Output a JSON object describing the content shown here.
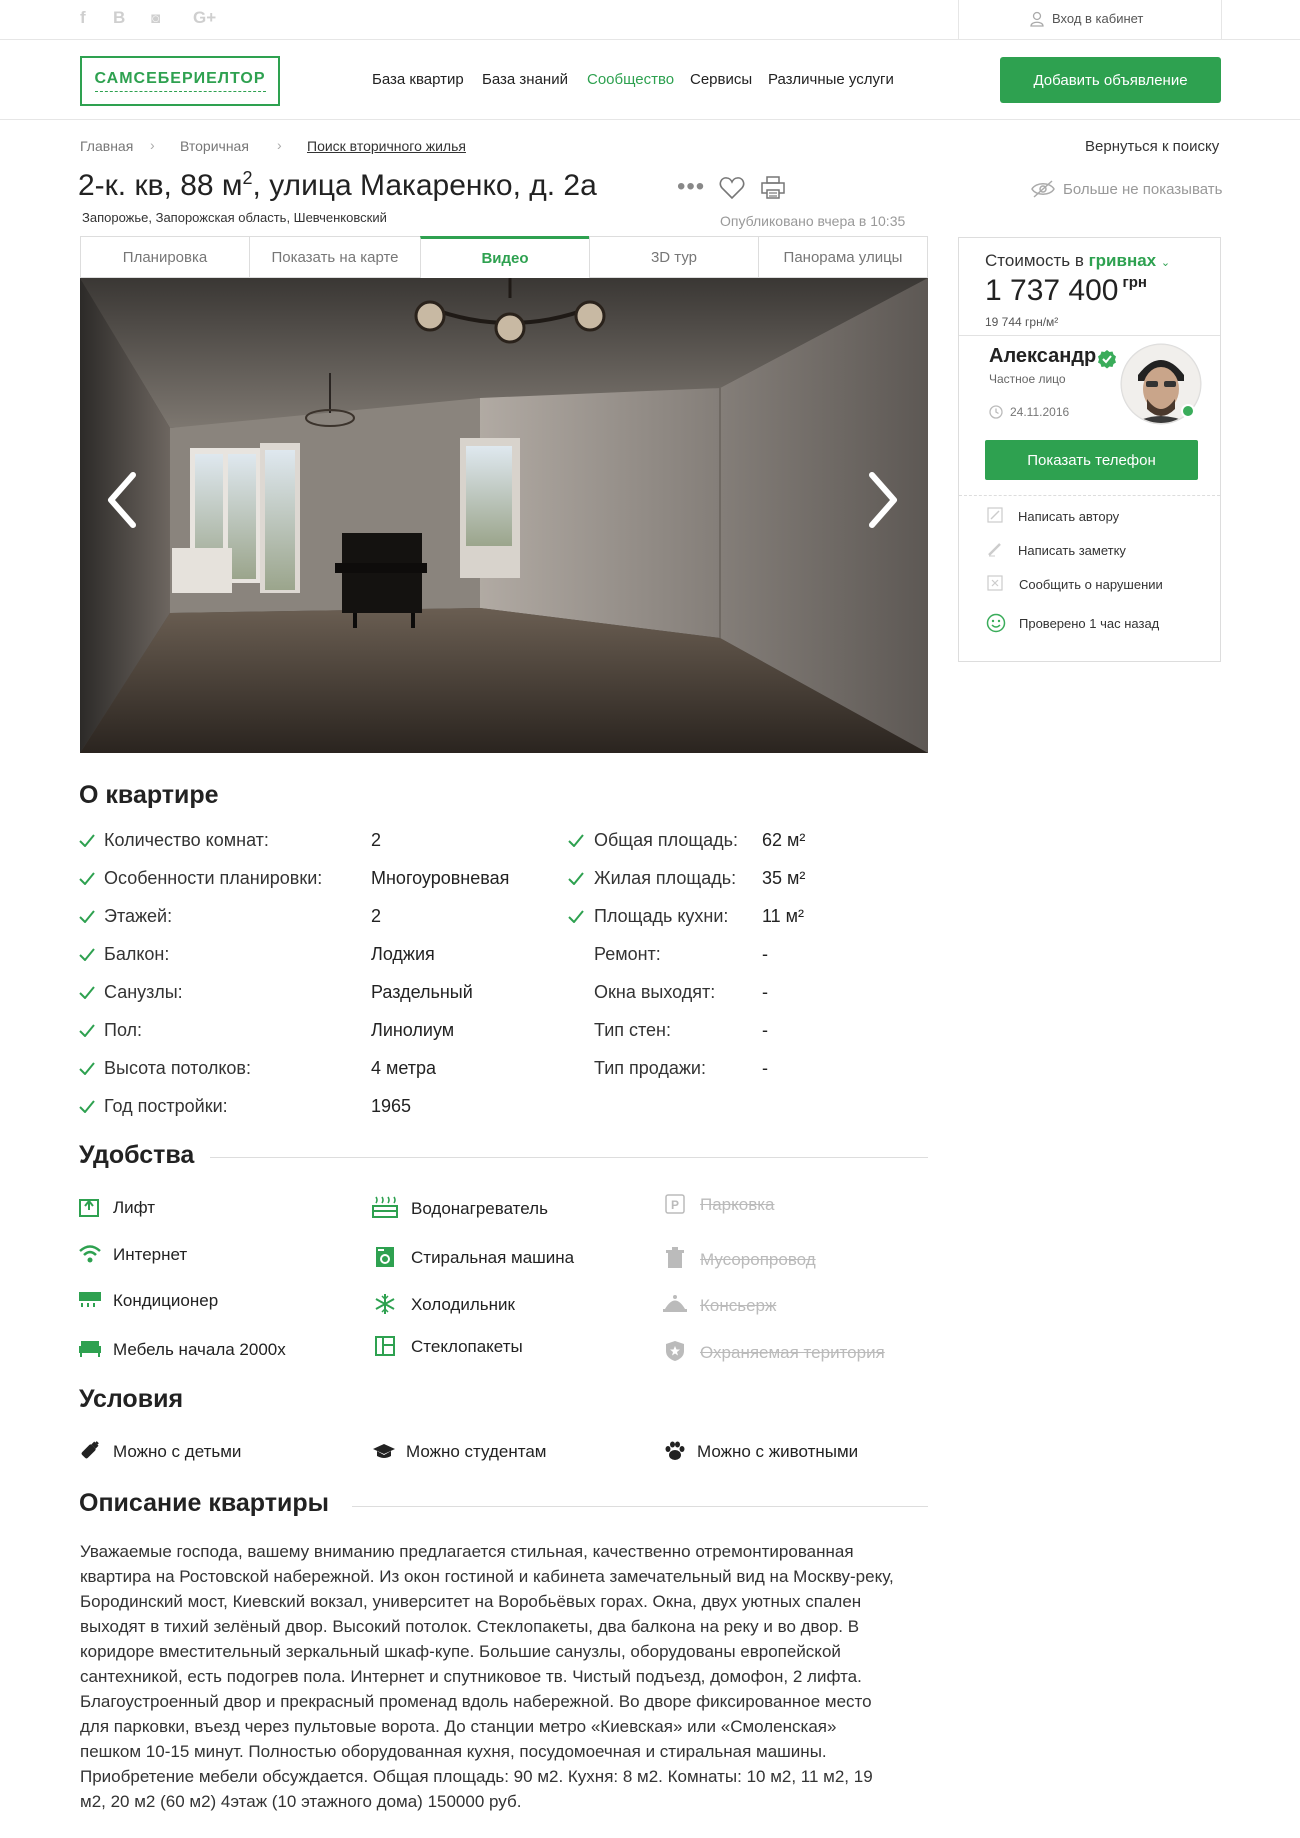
{
  "topbar": {
    "social": [
      "f",
      "B",
      "◙",
      "G+"
    ],
    "cabinet": "Вход в кабинет"
  },
  "header": {
    "logo": "САМСЕБЕРИЕЛТОР",
    "nav": [
      "База квартир",
      "База знаний",
      "Сообщество",
      "Сервисы",
      "Различные услуги"
    ],
    "add_button": "Добавить объявление"
  },
  "breadcrumbs": [
    "Главная",
    "Вторичная",
    "Поиск вторичного жилья"
  ],
  "back_link": "Вернуться к поиску",
  "listing": {
    "title_main": "2-к. кв, 88 м",
    "title_sup": "2",
    "title_rest": ", улица Макаренко, д. 2а",
    "address": "Запорожье, Запорожская область, Шевченковский",
    "published": "Опубликовано вчера в 10:35",
    "hide_link": "Больше не показывать"
  },
  "tabs": [
    "Планировка",
    "Показать на карте",
    "Видео",
    "3D тур",
    "Панорама улицы"
  ],
  "sidebar": {
    "cost_label": "Стоимость в ",
    "currency_link": "гривнах",
    "price": "1 737 400",
    "price_unit": "грн",
    "per_m2": "19 744 грн/м²",
    "seller_name": "Александр",
    "seller_type": "Частное лицо",
    "seller_date": "24.11.2016",
    "phone_button": "Показать телефон",
    "actions": [
      "Написать автору",
      "Написать заметку",
      "Сообщить о нарушении",
      "Проверено 1 час назад"
    ]
  },
  "about": {
    "heading": "О квартире",
    "left": [
      {
        "label": "Количество комнат:",
        "value": "2"
      },
      {
        "label": "Особенности планировки:",
        "value": "Многоуровневая"
      },
      {
        "label": "Этажей:",
        "value": "2"
      },
      {
        "label": "Балкон:",
        "value": "Лоджия"
      },
      {
        "label": "Санузлы:",
        "value": "Раздельный"
      },
      {
        "label": "Пол:",
        "value": "Линолиум"
      },
      {
        "label": "Высота потолков:",
        "value": "4 метра"
      },
      {
        "label": "Год постройки:",
        "value": "1965"
      }
    ],
    "right": [
      {
        "label": "Общая площадь:",
        "value": "62 м²",
        "checked": true
      },
      {
        "label": "Жилая площадь:",
        "value": "35 м²",
        "checked": true
      },
      {
        "label": "Площадь кухни:",
        "value": "11 м²",
        "checked": true
      },
      {
        "label": "Ремонт:",
        "value": "-",
        "checked": false
      },
      {
        "label": "Окна выходят:",
        "value": "-",
        "checked": false
      },
      {
        "label": "Тип стен:",
        "value": "-",
        "checked": false
      },
      {
        "label": "Тип продажи:",
        "value": "-",
        "checked": false
      }
    ]
  },
  "amenities": {
    "heading": "Удобства",
    "col1": [
      "Лифт",
      "Интернет",
      "Кондиционер",
      "Мебель начала 2000х"
    ],
    "col2": [
      "Водонагреватель",
      "Стиральная машина",
      "Холодильник",
      "Стеклопакеты"
    ],
    "col3_unavailable": [
      "Парковка",
      "Мусоропровод",
      "Консьерж",
      "Охраняемая територия"
    ]
  },
  "conditions": {
    "heading": "Условия",
    "items": [
      "Можно с детьми",
      "Можно студентам",
      "Можно с животными"
    ]
  },
  "description": {
    "heading": "Описание квартиры",
    "text": "Уважаемые господа, вашему вниманию предлагается стильная, качественно отремонтированная квартира на Ростовской набережной. Из окон гостиной и кабинета замечательный вид на Москву-реку, Бородинский мост, Киевский вокзал, университет на Воробьёвых горах. Окна, двух уютных спален выходят в тихий зелёный двор. Высокий потолок. Стеклопакеты, два балкона на реку и во двор. В коридоре вместительный зеркальный шкаф-купе. Большие санузлы, оборудованы европейской сантехникой, есть подогрев пола. Интернет и спутниковое тв. Чистый подъезд, домофон, 2 лифта. Благоустроенный двор и прекрасный променад вдоль набережной. Во дворе фиксированное место для парковки, въезд через пультовые ворота. До станции метро «Киевская» или «Смоленская» пешком 10-15 минут. Полностью оборудованная кухня, посудомоечная и стиральная машины. Приобретение мебели обсуждается. Общая площадь: 90 м2. Кухня: 8 м2. Комнаты: 10 м2, 11 м2, 19 м2, 20 м2 (60 м2) 4этаж (10 этажного дома) 150000 руб."
  },
  "colors": {
    "accent": "#2ea150"
  }
}
